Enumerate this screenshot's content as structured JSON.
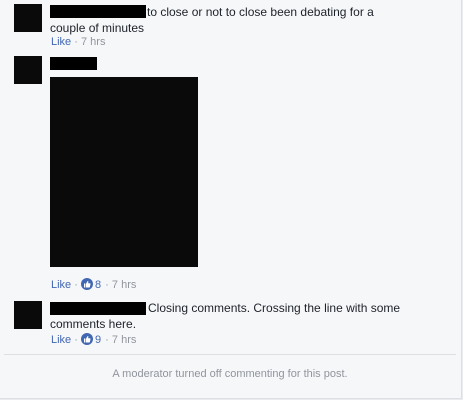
{
  "comments": [
    {
      "text": "to close or not to close been debating for a couple of minutes",
      "like_label": "Like",
      "separator": "·",
      "time": "7 hrs"
    },
    {
      "like_label": "Like",
      "reaction_count": "8",
      "separator": "·",
      "time": "7 hrs"
    },
    {
      "text": "Closing comments. Crossing the line with some comments here.",
      "like_label": "Like",
      "reaction_count": "9",
      "separator": "·",
      "time": "7 hrs"
    }
  ],
  "footer": {
    "notice": "A moderator turned off commenting for this post."
  },
  "icons": {
    "like": "thumbs-up-icon"
  },
  "colors": {
    "link_blue": "#4267b2",
    "meta_gray": "#90949c",
    "background": "#f6f7f9",
    "redaction": "#000000"
  }
}
